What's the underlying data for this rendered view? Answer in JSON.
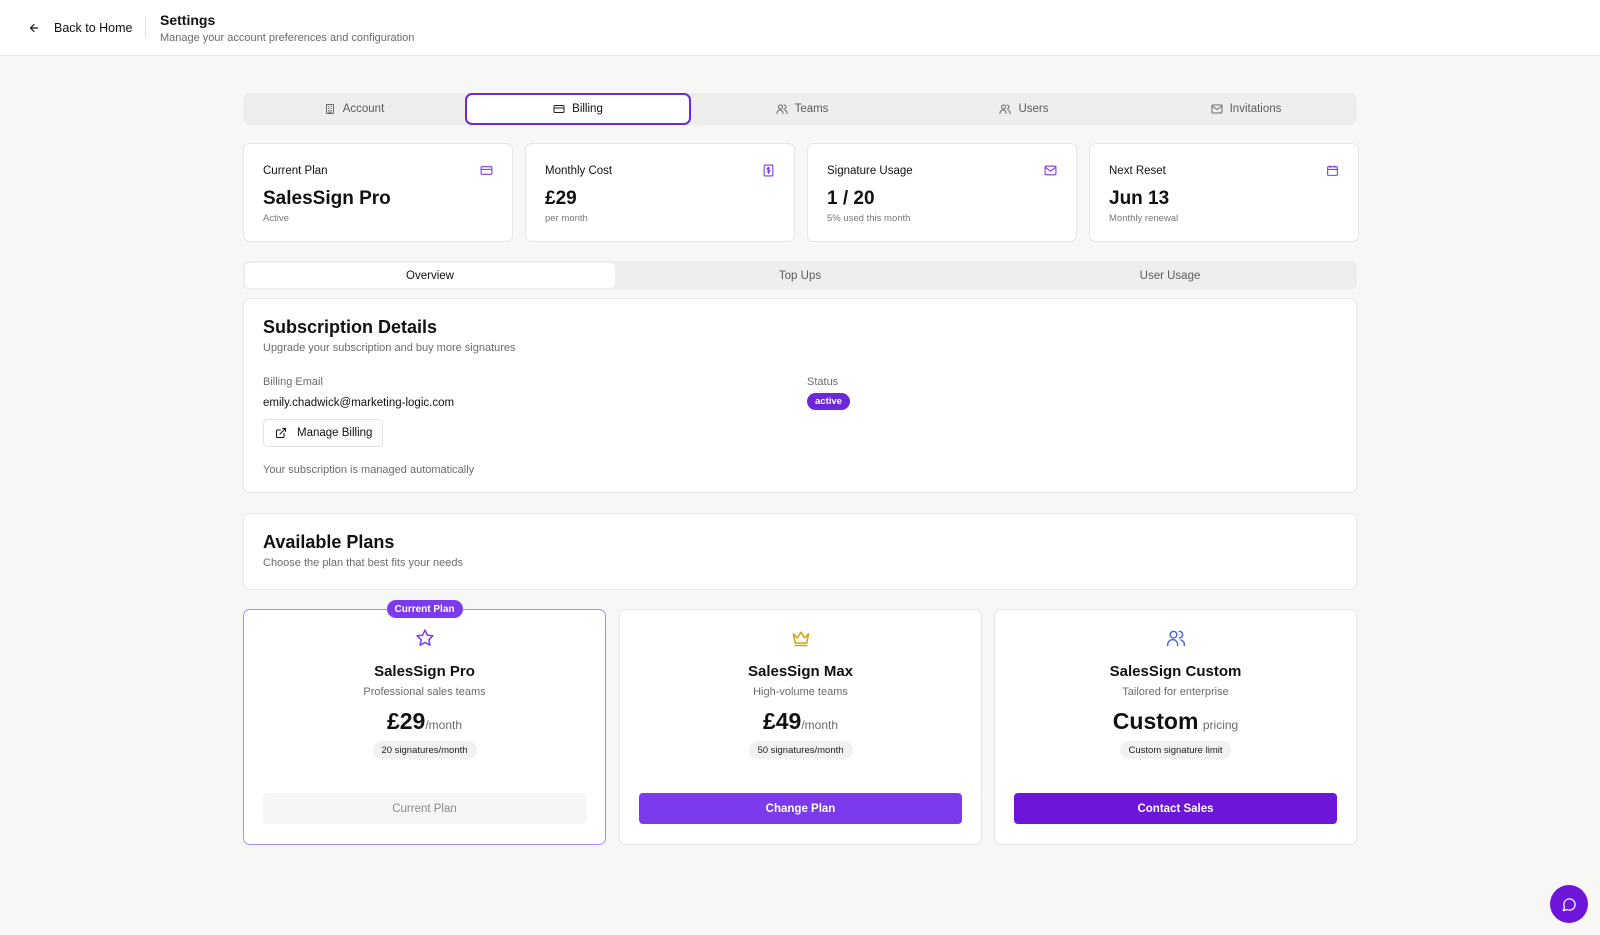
{
  "header": {
    "back_label": "Back to Home",
    "title": "Settings",
    "subtitle": "Manage your account preferences and configuration"
  },
  "tabs": [
    {
      "label": "Account",
      "icon": "building-icon",
      "active": false
    },
    {
      "label": "Billing",
      "icon": "credit-card-icon",
      "active": true
    },
    {
      "label": "Teams",
      "icon": "users-icon",
      "active": false
    },
    {
      "label": "Users",
      "icon": "users-icon",
      "active": false
    },
    {
      "label": "Invitations",
      "icon": "mail-icon",
      "active": false
    }
  ],
  "stats": [
    {
      "label": "Current Plan",
      "value": "SalesSign Pro",
      "sub": "Active",
      "icon": "credit-card-icon"
    },
    {
      "label": "Monthly Cost",
      "value": "£29",
      "sub": "per month",
      "icon": "receipt-icon"
    },
    {
      "label": "Signature Usage",
      "value": "1 / 20",
      "sub": "5% used this month",
      "icon": "mail-icon"
    },
    {
      "label": "Next Reset",
      "value": "Jun 13",
      "sub": "Monthly renewal",
      "icon": "calendar-icon"
    }
  ],
  "subtabs": [
    {
      "label": "Overview",
      "active": true
    },
    {
      "label": "Top Ups",
      "active": false
    },
    {
      "label": "User Usage",
      "active": false
    }
  ],
  "subscription": {
    "title": "Subscription Details",
    "description": "Upgrade your subscription and buy more signatures",
    "billing_email_label": "Billing Email",
    "billing_email": "emily.chadwick@marketing-logic.com",
    "manage_button": "Manage Billing",
    "status_label": "Status",
    "status_value": "active",
    "note": "Your subscription is managed automatically"
  },
  "available_plans": {
    "title": "Available Plans",
    "description": "Choose the plan that best fits your needs"
  },
  "plans": [
    {
      "name": "SalesSign Pro",
      "desc": "Professional sales teams",
      "price": "£29",
      "period": "/month",
      "limit": "20 signatures/month",
      "button": "Current Plan",
      "tag": "Current Plan",
      "icon": "star-icon"
    },
    {
      "name": "SalesSign Max",
      "desc": "High-volume teams",
      "price": "£49",
      "period": "/month",
      "limit": "50 signatures/month",
      "button": "Change Plan",
      "icon": "crown-icon"
    },
    {
      "name": "SalesSign Custom",
      "desc": "Tailored for enterprise",
      "price": "Custom",
      "period": "pricing",
      "limit": "Custom signature limit",
      "button": "Contact Sales",
      "icon": "users-icon"
    }
  ],
  "colors": {
    "accent": "#7c3aed",
    "accent_dark": "#6d16d9",
    "crown": "#d4a017",
    "team_blue": "#4f6bd9"
  }
}
